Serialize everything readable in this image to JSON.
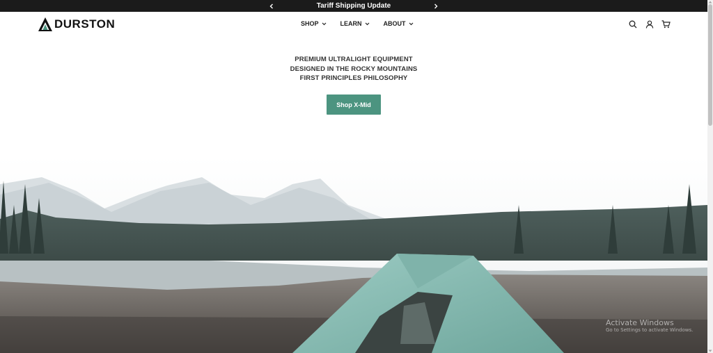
{
  "announcement": {
    "text": "Tariff Shipping Update",
    "prev_icon": "chevron-left-icon",
    "next_icon": "chevron-right-icon"
  },
  "header": {
    "logo_text": "DURSTON",
    "nav": [
      {
        "label": "SHOP"
      },
      {
        "label": "LEARN"
      },
      {
        "label": "ABOUT"
      }
    ],
    "icons": [
      "search-icon",
      "account-icon",
      "cart-icon"
    ]
  },
  "hero": {
    "lines": [
      "PREMIUM ULTRALIGHT EQUIPMENT",
      "DESIGNED IN THE ROCKY MOUNTAINS",
      "FIRST PRINCIPLES PHILOSOPHY"
    ],
    "cta_label": "Shop X-Mid"
  },
  "watermark": {
    "line1": "Activate Windows",
    "line2": "Go to Settings to activate Windows."
  },
  "colors": {
    "accent": "#4c9480",
    "topbar": "#1b1b1b",
    "tent": "#8fc1b8"
  }
}
